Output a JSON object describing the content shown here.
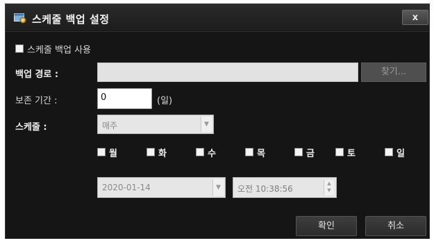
{
  "title": "스케줄 백업 설정",
  "close_label": "x",
  "enable_label": "스케줄 백업 사용",
  "backup_path": {
    "label": "백업 경로 :",
    "value": "",
    "find_button": "찾기..."
  },
  "retention": {
    "label": "보존 기간 :",
    "value": "0",
    "unit": "(일)"
  },
  "schedule": {
    "label": "스케줄 :",
    "selected": "매주"
  },
  "days": [
    "월",
    "화",
    "수",
    "목",
    "금",
    "토",
    "일"
  ],
  "date": "2020-01-14",
  "time": "오전 10:38:56",
  "buttons": {
    "ok": "확인",
    "cancel": "취소"
  },
  "icons": {
    "title": "settings-window-icon",
    "dropdown": "chevron-down-icon",
    "spin": "spin-arrows-icon"
  }
}
